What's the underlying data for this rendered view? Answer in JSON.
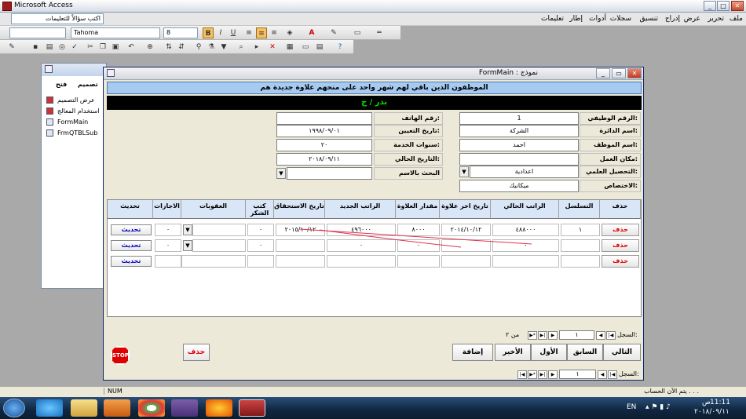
{
  "app": {
    "title": "Microsoft Access"
  },
  "menu": [
    "ملف",
    "تحرير",
    "عرض",
    "إدراج",
    "تنسيق",
    "سجلات",
    "أدوات",
    "إطار",
    "تعليمات"
  ],
  "question_box": {
    "placeholder": "اكتب سؤالاً للتعليمات"
  },
  "format_toolbar": {
    "font": "Tahoma",
    "size": "8"
  },
  "left_pane": {
    "items": [
      "عرض التصميم",
      "استخدام المعالج",
      "FormMain",
      "FrmQTBLSub"
    ],
    "toolbar": [
      "تصميم",
      "فتح"
    ]
  },
  "form": {
    "title": "FormMain : نموذج",
    "header": "الموظفون الذين باقي لهم شهر واحد على منحهم علاوة جديدة هم",
    "employee_name_display": "بدر / ح",
    "labels": {
      "employee_id": "الرقم الوظيفي:",
      "department": "اسم الدائرة:",
      "employee_name": "اسم الموظف:",
      "workplace": "مكان العمل:",
      "education": "التحصيل العلمي:",
      "specialization": "الاختصاص:",
      "phone": "رقم الهاتف:",
      "hire_date": "تاريخ التعيين:",
      "years_service": "سنوات الخدمة:",
      "current_date": "التاريخ الحالي:",
      "search_name": "البحث بالاسم"
    },
    "values": {
      "employee_id": "1",
      "department": "الشركة",
      "employee_name": "احمد",
      "workplace": "",
      "education": "اعدادية",
      "specialization": "ميكانيك",
      "phone": "",
      "hire_date": "١٩٩٨/٠٩/٠١",
      "years_service": "٢٠",
      "current_date": "٢٠١٨/٠٩/١١",
      "search_name": ""
    },
    "grid": {
      "headers": [
        "حذف",
        "التسلسل",
        "الراتب الحالي",
        "تاريخ اخر علاوة",
        "مقدار العلاوة",
        "الراتب الجديد",
        "تاريخ الاستحقاق",
        "كتب الشكر",
        "العقوبات",
        "الاجازات",
        "تحديث"
      ],
      "rows": [
        {
          "delete": "حذف",
          "seq": "١",
          "salary": "٤٨٨٠٠٠",
          "last_raise": "٢٠١٤/١٠/١٢",
          "raise_amount": "٨٠٠٠",
          "new_salary": "٤٩٦٠٠٠",
          "due_date": "٢٠١٥/١٠/١٢",
          "thanks": "٠",
          "penalties": "",
          "leaves": "٠",
          "update": "تحديث"
        },
        {
          "delete": "حذف",
          "seq": "",
          "salary": "٠",
          "last_raise": "",
          "raise_amount": "٠",
          "new_salary": "٠",
          "due_date": "",
          "thanks": "٠",
          "penalties": "",
          "leaves": "٠",
          "update": "تحديث"
        },
        {
          "delete": "حذف",
          "seq": "",
          "salary": "",
          "last_raise": "",
          "raise_amount": "",
          "new_salary": "",
          "due_date": "",
          "thanks": "",
          "penalties": "",
          "leaves": "",
          "update": "تحديث"
        }
      ]
    },
    "subnav": {
      "label": "السجل:",
      "record": "١",
      "of": "من ٢"
    },
    "buttons": {
      "next": "التالي",
      "prev": "السابق",
      "first": "الأول",
      "last": "الأخير",
      "add": "إضافة",
      "delete": "حذف",
      "stop": "STOP"
    },
    "mainnav": {
      "label": "السجل:",
      "record": "١"
    }
  },
  "status": {
    "left": "يتم الآن الحساب . . .",
    "num": "NUM"
  },
  "taskbar": {
    "lang": "EN",
    "time": "11:11",
    "ampm": "ص",
    "date": "٢٠١٨/٠٩/١١"
  },
  "colors": {
    "accent": "#a6caf0",
    "name_bar_text": "#00e000",
    "delete_red": "#e00000"
  }
}
